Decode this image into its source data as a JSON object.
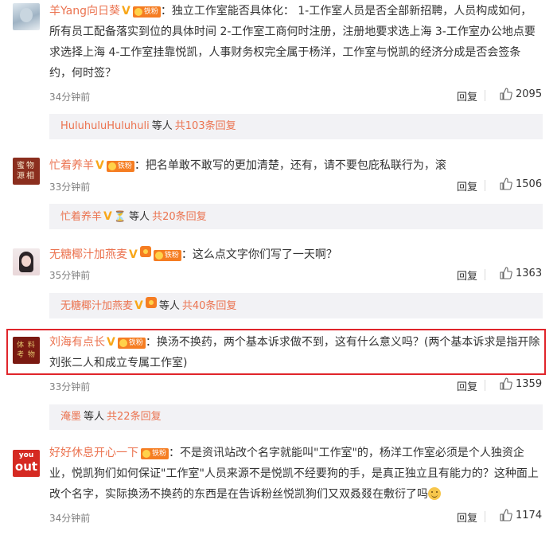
{
  "fan_badge_label": "铁粉",
  "comments": [
    {
      "username": "羊Yang向日葵",
      "text": "：独立工作室能否具体化： 1-工作室人员是否全部新招聘，人员构成如何，所有员工配备落实到位的具体时间 2-工作室工商何时注册，注册地要求选上海 3-工作室办公地点要求选择上海 4-工作室挂靠悦凯，人事财务权完全属于杨洋，工作室与悦凯的经济分成是否会签条约，何时签？",
      "time": "34分钟前",
      "reply": "回复",
      "likes": "2095",
      "sub": {
        "names": "HuluhuluHuluhuli",
        "etc": "等人",
        "more": "共103条回复"
      }
    },
    {
      "username": "忙着养羊",
      "avatar_text": "蜜物 源相",
      "text": "：把名单敢不敢写的更加清楚，还有，请不要包庇私联行为，滚",
      "time": "33分钟前",
      "reply": "回复",
      "likes": "1506",
      "sub": {
        "names": "忙着养羊",
        "etc": "等人",
        "more": "共20条回复"
      }
    },
    {
      "username": "无糖椰汁加燕麦",
      "text": "：这么点文字你们写了一天啊？",
      "time": "35分钟前",
      "reply": "回复",
      "likes": "1363",
      "sub": {
        "names": "无糖椰汁加燕麦",
        "etc": "等人",
        "more": "共40条回复"
      }
    },
    {
      "username": "刘海有点长",
      "avatar_text": "体 料 考 物",
      "text": "：换汤不换药，两个基本诉求做不到，这有什么意义吗？(两个基本诉求是指开除刘张二人和成立专属工作室)",
      "time": "33分钟前",
      "reply": "回复",
      "likes": "1359",
      "sub": {
        "names": "淹墨",
        "etc": "等人",
        "more": "共22条回复"
      }
    },
    {
      "username": "好好休息开心一下",
      "avatar_text_1": "you",
      "avatar_text_2": "out",
      "text": "：不是资讯站改个名字就能叫\"工作室\"的，杨洋工作室必须是个人独资企业，悦凯狗们如何保证\"工作室\"人员来源不是悦凯不经要狗的手，是真正独立且有能力的？这种面上改个名字，实际换汤不换药的东西是在告诉粉丝悦凯狗们又双叒叕在敷衍了吗",
      "time": "34分钟前",
      "reply": "回复",
      "likes": "1174"
    }
  ]
}
